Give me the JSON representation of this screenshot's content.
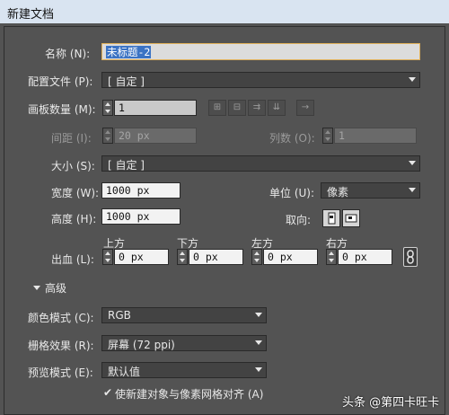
{
  "window": {
    "title": "新建文档"
  },
  "name": {
    "label": "名称 (N):",
    "value": "未标题-2"
  },
  "profile": {
    "label": "配置文件 (P):",
    "value": "[ 自定 ]"
  },
  "artboards": {
    "label": "画板数量 (M):",
    "value": "1",
    "spacing_label": "间距 (I):",
    "spacing_value": "20 px",
    "columns_label": "列数 (O):",
    "columns_value": "1"
  },
  "size": {
    "label": "大小 (S):",
    "value": "[ 自定 ]"
  },
  "width": {
    "label": "宽度 (W):",
    "value": "1000 px"
  },
  "units": {
    "label": "单位 (U):",
    "value": "像素"
  },
  "height": {
    "label": "高度 (H):",
    "value": "1000 px"
  },
  "orientation": {
    "label": "取向:"
  },
  "bleed": {
    "label": "出血 (L):",
    "top_label": "上方",
    "top_value": "0 px",
    "bottom_label": "下方",
    "bottom_value": "0 px",
    "left_label": "左方",
    "left_value": "0 px",
    "right_label": "右方",
    "right_value": "0 px"
  },
  "advanced": {
    "toggle_label": "高级",
    "color_mode_label": "颜色模式 (C):",
    "color_mode_value": "RGB",
    "raster_label": "栅格效果 (R):",
    "raster_value": "屏幕 (72 ppi)",
    "preview_label": "预览模式 (E):",
    "preview_value": "默认值",
    "align_checkbox_label": "使新建对象与像素网格对齐 (A)"
  },
  "watermark": {
    "text": "头条 @第四卡旺卡"
  },
  "colors": {
    "dialog_bg": "#535353",
    "title_bar": "#d9e4f1",
    "selection": "#3b73c4"
  }
}
